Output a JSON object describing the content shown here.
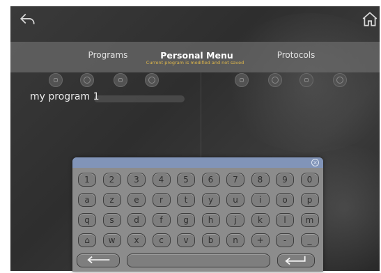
{
  "header": {
    "back_icon": "back-arrow-icon",
    "home_icon": "home-icon"
  },
  "tabs": [
    {
      "label": "Programs",
      "active": false
    },
    {
      "label": "Personal Menu",
      "active": true
    },
    {
      "label": "Protocols",
      "active": false
    }
  ],
  "status_message": "Current program is modified and not saved",
  "left_panel": {
    "program_name": "my program 1",
    "icons": [
      "stop-icon",
      "play-icon",
      "edit-icon",
      "delete-icon"
    ]
  },
  "right_panel": {
    "icons": [
      "stop-icon",
      "play-icon",
      "edit-icon",
      "delete-icon"
    ]
  },
  "keyboard": {
    "close_icon": "close-icon",
    "rows": [
      [
        "1",
        "2",
        "3",
        "4",
        "5",
        "6",
        "7",
        "8",
        "9",
        "0"
      ],
      [
        "a",
        "z",
        "e",
        "r",
        "t",
        "y",
        "u",
        "i",
        "o",
        "p"
      ],
      [
        "q",
        "s",
        "d",
        "f",
        "g",
        "h",
        "j",
        "k",
        "l",
        "m"
      ],
      [
        "⌂",
        "w",
        "x",
        "c",
        "v",
        "b",
        "n",
        "+",
        "-",
        "_"
      ]
    ],
    "backspace_icon": "backspace-arrow-icon",
    "enter_icon": "enter-arrow-icon"
  },
  "colors": {
    "accent_text": "#e0b84a",
    "keyboard_header": "#8194b8"
  }
}
